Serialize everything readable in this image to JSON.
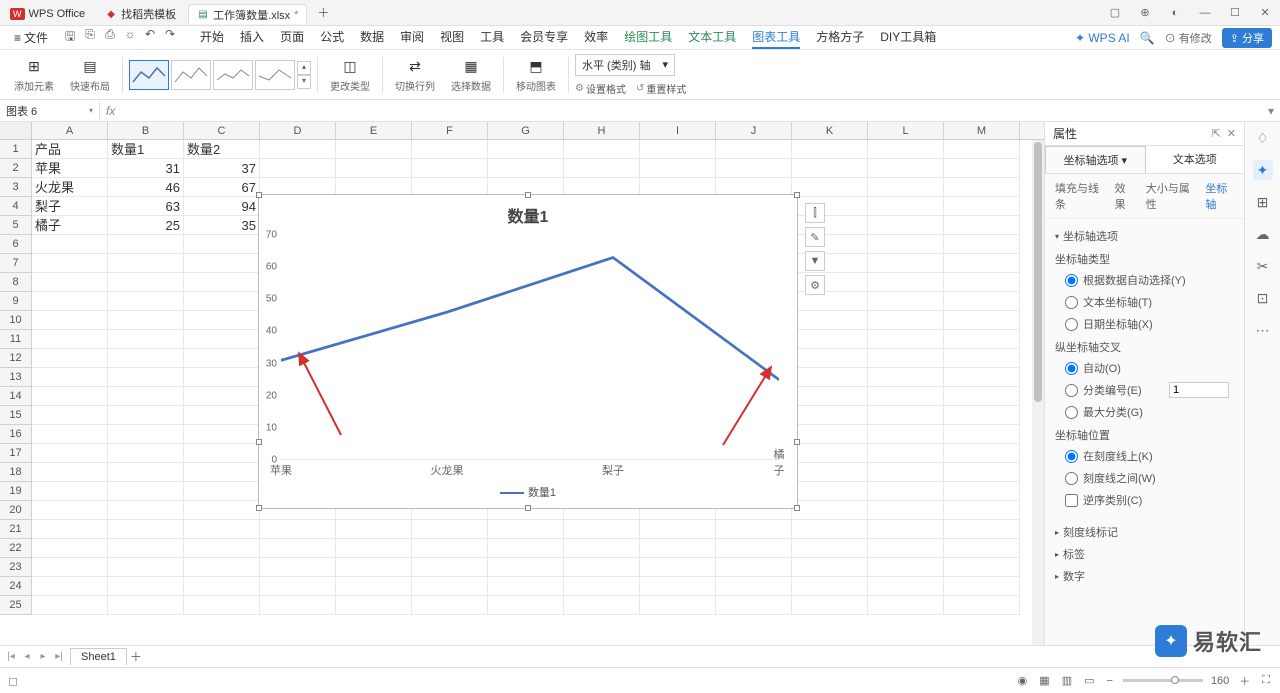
{
  "app": {
    "name": "WPS Office"
  },
  "tabs": [
    {
      "icon": "D",
      "label": "找稻壳模板",
      "iconColor": "#d32f2f"
    },
    {
      "icon": "S",
      "label": "工作簿数量.xlsx",
      "iconColor": "#2e8b57",
      "dirty": "*"
    }
  ],
  "fileMenu": "文件",
  "menus": [
    "开始",
    "插入",
    "页面",
    "公式",
    "数据",
    "审阅",
    "视图",
    "工具",
    "会员专享",
    "效率",
    "绘图工具",
    "文本工具",
    "图表工具",
    "方格方子",
    "DIY工具箱"
  ],
  "menuActive": 12,
  "menuGreenStart": 10,
  "wpsAI": "WPS AI",
  "modText": "有修改",
  "shareBtn": "分享",
  "ribbon": {
    "addEl": "添加元素",
    "quickLayout": "快速布局",
    "changeType": "更改类型",
    "switchRowCol": "切换行列",
    "selData": "选择数据",
    "moveChart": "移动图表",
    "axisSel": "水平 (类别) 轴",
    "setFmt": "设置格式",
    "resetStyle": "重置样式"
  },
  "nameBox": "图表 6",
  "columns": [
    "A",
    "B",
    "C",
    "D",
    "E",
    "F",
    "G",
    "H",
    "I",
    "J",
    "K",
    "L",
    "M"
  ],
  "rowCount": 25,
  "table": {
    "headers": [
      "产品",
      "数量1",
      "数量2"
    ],
    "rows": [
      [
        "苹果",
        "31",
        "37"
      ],
      [
        "火龙果",
        "46",
        "67"
      ],
      [
        "梨子",
        "63",
        "94"
      ],
      [
        "橘子",
        "25",
        "35"
      ]
    ]
  },
  "chart_data": {
    "type": "line",
    "title": "数量1",
    "categories": [
      "苹果",
      "火龙果",
      "梨子",
      "橘子"
    ],
    "series": [
      {
        "name": "数量1",
        "values": [
          31,
          46,
          63,
          25
        ]
      }
    ],
    "y_ticks": [
      0,
      10,
      20,
      30,
      40,
      50,
      60,
      70
    ],
    "ylim": [
      0,
      70
    ]
  },
  "propPane": {
    "title": "属性",
    "tabs": [
      "坐标轴选项",
      "文本选项"
    ],
    "subtabs": [
      "填充与线条",
      "效果",
      "大小与属性",
      "坐标轴"
    ],
    "subActive": 3,
    "sec1": "坐标轴选项",
    "axisType": "坐标轴类型",
    "axisTypeOpts": [
      "根据数据自动选择(Y)",
      "文本坐标轴(T)",
      "日期坐标轴(X)"
    ],
    "crossTitle": "纵坐标轴交叉",
    "crossOpts": [
      "自动(O)",
      "分类编号(E)",
      "最大分类(G)"
    ],
    "crossNum": "1",
    "posTitle": "坐标轴位置",
    "posOpts": [
      "在刻度线上(K)",
      "刻度线之间(W)"
    ],
    "reverse": "逆序类别(C)",
    "sec2": "刻度线标记",
    "sec3": "标签",
    "sec4": "数字"
  },
  "sheet": "Sheet1",
  "zoom": "160",
  "watermark": "易软汇"
}
